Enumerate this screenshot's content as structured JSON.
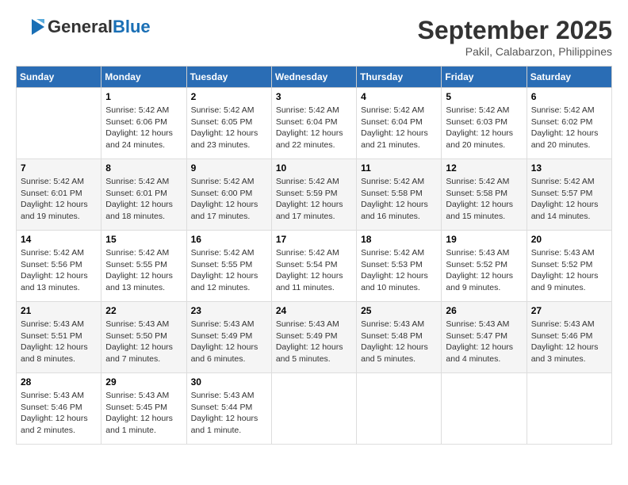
{
  "header": {
    "logo_general": "General",
    "logo_blue": "Blue",
    "month": "September 2025",
    "location": "Pakil, Calabarzon, Philippines"
  },
  "weekdays": [
    "Sunday",
    "Monday",
    "Tuesday",
    "Wednesday",
    "Thursday",
    "Friday",
    "Saturday"
  ],
  "weeks": [
    [
      {
        "day": "",
        "info": ""
      },
      {
        "day": "1",
        "info": "Sunrise: 5:42 AM\nSunset: 6:06 PM\nDaylight: 12 hours\nand 24 minutes."
      },
      {
        "day": "2",
        "info": "Sunrise: 5:42 AM\nSunset: 6:05 PM\nDaylight: 12 hours\nand 23 minutes."
      },
      {
        "day": "3",
        "info": "Sunrise: 5:42 AM\nSunset: 6:04 PM\nDaylight: 12 hours\nand 22 minutes."
      },
      {
        "day": "4",
        "info": "Sunrise: 5:42 AM\nSunset: 6:04 PM\nDaylight: 12 hours\nand 21 minutes."
      },
      {
        "day": "5",
        "info": "Sunrise: 5:42 AM\nSunset: 6:03 PM\nDaylight: 12 hours\nand 20 minutes."
      },
      {
        "day": "6",
        "info": "Sunrise: 5:42 AM\nSunset: 6:02 PM\nDaylight: 12 hours\nand 20 minutes."
      }
    ],
    [
      {
        "day": "7",
        "info": "Sunrise: 5:42 AM\nSunset: 6:01 PM\nDaylight: 12 hours\nand 19 minutes."
      },
      {
        "day": "8",
        "info": "Sunrise: 5:42 AM\nSunset: 6:01 PM\nDaylight: 12 hours\nand 18 minutes."
      },
      {
        "day": "9",
        "info": "Sunrise: 5:42 AM\nSunset: 6:00 PM\nDaylight: 12 hours\nand 17 minutes."
      },
      {
        "day": "10",
        "info": "Sunrise: 5:42 AM\nSunset: 5:59 PM\nDaylight: 12 hours\nand 17 minutes."
      },
      {
        "day": "11",
        "info": "Sunrise: 5:42 AM\nSunset: 5:58 PM\nDaylight: 12 hours\nand 16 minutes."
      },
      {
        "day": "12",
        "info": "Sunrise: 5:42 AM\nSunset: 5:58 PM\nDaylight: 12 hours\nand 15 minutes."
      },
      {
        "day": "13",
        "info": "Sunrise: 5:42 AM\nSunset: 5:57 PM\nDaylight: 12 hours\nand 14 minutes."
      }
    ],
    [
      {
        "day": "14",
        "info": "Sunrise: 5:42 AM\nSunset: 5:56 PM\nDaylight: 12 hours\nand 13 minutes."
      },
      {
        "day": "15",
        "info": "Sunrise: 5:42 AM\nSunset: 5:55 PM\nDaylight: 12 hours\nand 13 minutes."
      },
      {
        "day": "16",
        "info": "Sunrise: 5:42 AM\nSunset: 5:55 PM\nDaylight: 12 hours\nand 12 minutes."
      },
      {
        "day": "17",
        "info": "Sunrise: 5:42 AM\nSunset: 5:54 PM\nDaylight: 12 hours\nand 11 minutes."
      },
      {
        "day": "18",
        "info": "Sunrise: 5:42 AM\nSunset: 5:53 PM\nDaylight: 12 hours\nand 10 minutes."
      },
      {
        "day": "19",
        "info": "Sunrise: 5:43 AM\nSunset: 5:52 PM\nDaylight: 12 hours\nand 9 minutes."
      },
      {
        "day": "20",
        "info": "Sunrise: 5:43 AM\nSunset: 5:52 PM\nDaylight: 12 hours\nand 9 minutes."
      }
    ],
    [
      {
        "day": "21",
        "info": "Sunrise: 5:43 AM\nSunset: 5:51 PM\nDaylight: 12 hours\nand 8 minutes."
      },
      {
        "day": "22",
        "info": "Sunrise: 5:43 AM\nSunset: 5:50 PM\nDaylight: 12 hours\nand 7 minutes."
      },
      {
        "day": "23",
        "info": "Sunrise: 5:43 AM\nSunset: 5:49 PM\nDaylight: 12 hours\nand 6 minutes."
      },
      {
        "day": "24",
        "info": "Sunrise: 5:43 AM\nSunset: 5:49 PM\nDaylight: 12 hours\nand 5 minutes."
      },
      {
        "day": "25",
        "info": "Sunrise: 5:43 AM\nSunset: 5:48 PM\nDaylight: 12 hours\nand 5 minutes."
      },
      {
        "day": "26",
        "info": "Sunrise: 5:43 AM\nSunset: 5:47 PM\nDaylight: 12 hours\nand 4 minutes."
      },
      {
        "day": "27",
        "info": "Sunrise: 5:43 AM\nSunset: 5:46 PM\nDaylight: 12 hours\nand 3 minutes."
      }
    ],
    [
      {
        "day": "28",
        "info": "Sunrise: 5:43 AM\nSunset: 5:46 PM\nDaylight: 12 hours\nand 2 minutes."
      },
      {
        "day": "29",
        "info": "Sunrise: 5:43 AM\nSunset: 5:45 PM\nDaylight: 12 hours\nand 1 minute."
      },
      {
        "day": "30",
        "info": "Sunrise: 5:43 AM\nSunset: 5:44 PM\nDaylight: 12 hours\nand 1 minute."
      },
      {
        "day": "",
        "info": ""
      },
      {
        "day": "",
        "info": ""
      },
      {
        "day": "",
        "info": ""
      },
      {
        "day": "",
        "info": ""
      }
    ]
  ]
}
